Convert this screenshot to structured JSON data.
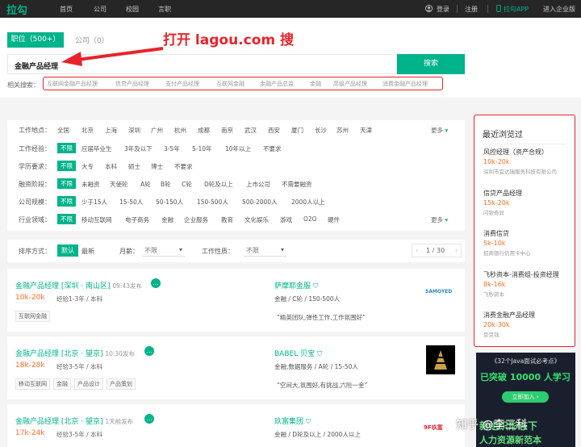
{
  "topbar": {
    "logo": "拉勾",
    "nav": [
      "首页",
      "公司",
      "校园",
      "言职"
    ],
    "login": "登录",
    "register": "注册",
    "app": "拉勾APP",
    "enterprise": "进入企业版"
  },
  "search": {
    "tab_jobs": "职位（500+）",
    "tab_companies": "公司（0）",
    "query": "金融产品经理",
    "button": "搜索",
    "annotation": "打开 lagou.com 搜",
    "related_label": "相关搜索：",
    "related": [
      "互联网金融产品经理",
      "信贷产品经理",
      "支付产品经理",
      "互联网金融",
      "金融产品总监",
      "金融",
      "高级产品经理",
      "消费金融产品经理"
    ]
  },
  "filters": {
    "more": "更多",
    "rows": [
      {
        "label": "工作地点：",
        "options": [
          "全国",
          "北京",
          "上海",
          "深圳",
          "广州",
          "杭州",
          "成都",
          "南京",
          "武汉",
          "西安",
          "厦门",
          "长沙",
          "苏州",
          "天津"
        ],
        "selected": -1,
        "more": true
      },
      {
        "label": "工作经验：",
        "options": [
          "不限",
          "应届毕业生",
          "3年及以下",
          "3-5年",
          "5-10年",
          "10年以上",
          "不要求"
        ],
        "selected": 0,
        "more": false
      },
      {
        "label": "学历要求：",
        "options": [
          "不限",
          "大专",
          "本科",
          "硕士",
          "博士",
          "不要求"
        ],
        "selected": 0,
        "more": false
      },
      {
        "label": "融资阶段：",
        "options": [
          "不限",
          "未融资",
          "天使轮",
          "A轮",
          "B轮",
          "C轮",
          "D轮及以上",
          "上市公司",
          "不需要融资"
        ],
        "selected": 0,
        "more": false
      },
      {
        "label": "公司规模：",
        "options": [
          "不限",
          "少于15人",
          "15-50人",
          "50-150人",
          "150-500人",
          "500-2000人",
          "2000人以上"
        ],
        "selected": 0,
        "more": false
      },
      {
        "label": "行业领域：",
        "options": [
          "不限",
          "移动互联网",
          "电子商务",
          "金融",
          "企业服务",
          "教育",
          "文化娱乐",
          "游戏",
          "O2O",
          "硬件"
        ],
        "selected": 0,
        "more": true
      }
    ]
  },
  "sort": {
    "label": "排序方式：",
    "default": "默认",
    "newest": "最新",
    "monthly_label": "月薪：",
    "monthly_value": "不限",
    "nature_label": "工作性质：",
    "nature_value": "不限",
    "page": "1 / 30"
  },
  "jobs": [
    {
      "title": "金融产品经理 [深圳 · 南山区]",
      "time": "09:43发布",
      "salary": "10k-20k",
      "req": "经验1-3年 / 本科",
      "tags": [
        "互联网金融"
      ],
      "company": "萨摩耶金服",
      "company_info": "金融 / C轮 / 150-500人",
      "quote": "“精英团队,弹性工作,工作氛围好”",
      "logo_text": "SAMOYED"
    },
    {
      "title": "金融产品经理 [北京 · 望京]",
      "time": "10:30发布",
      "salary": "18k-28k",
      "req": "经验3-5年 / 本科",
      "tags": [
        "移动互联网",
        "金融",
        "产品设计",
        "产品策划"
      ],
      "company": "BABEL 贝宝",
      "company_info": "金融,数据服务 / A轮 / 15-50人",
      "quote": "“空间大,氛围好,有挑战,六险一金”",
      "logo_text": ""
    },
    {
      "title": "金融产品经理 [北京 · 望京]",
      "time": "1天前发布",
      "salary": "17k-24k",
      "req": "经验3-5年 / 本科",
      "tags": [],
      "company": "玖富集团",
      "company_info": "金融 / D轮及以上 / 2000人以上",
      "quote": "",
      "logo_text": "9F玖富"
    }
  ],
  "sidebar": {
    "title": "最近浏览过",
    "items": [
      {
        "name": "风控经理（资产合规）",
        "salary": "10k-20k",
        "company": "深圳市宜达瑞服务科技有限公司"
      },
      {
        "name": "信贷产品经理",
        "salary": "15k-20k",
        "company": "闪银奇异"
      },
      {
        "name": "消费信贷",
        "salary": "5k-10k",
        "company": "招商银行信用卡中心"
      },
      {
        "name": "飞秒资本-消费组-投资经理",
        "salary": "8k-16k",
        "company": "飞秒资本"
      },
      {
        "name": "消费金融产品经理",
        "salary": "20k-30k",
        "company": "豆豆钱"
      }
    ]
  },
  "ad": {
    "line1": "《32个Java面试必考点》",
    "line2": "已突破 10000 人学习",
    "button": "立即加入 ›",
    "line3": "新组织形态下",
    "line4": "人力资源新范本"
  },
  "watermark": "知乎 @李三科"
}
